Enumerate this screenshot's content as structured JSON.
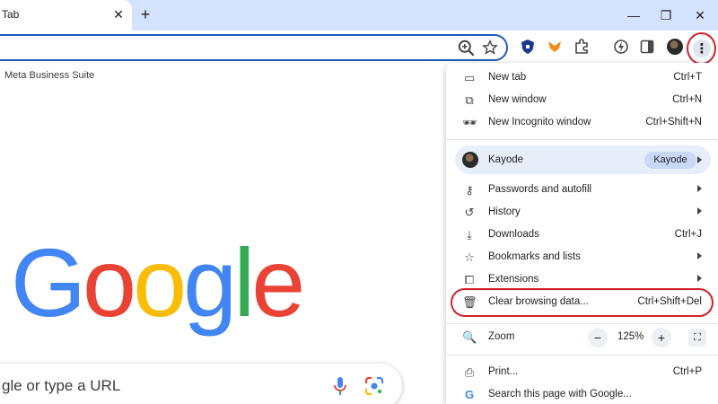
{
  "tab": {
    "title": "Tab",
    "close": "✕",
    "new_tab": "+"
  },
  "window_controls": {
    "minimize": "—",
    "maximize": "❐",
    "close": "✕"
  },
  "bookmarks_bar": {
    "item": "Meta Business Suite"
  },
  "google_logo": {
    "letters": [
      "G",
      "o",
      "o",
      "g",
      "l",
      "e"
    ],
    "colors": [
      "#4285F4",
      "#EA4335",
      "#FBBC05",
      "#4285F4",
      "#34A853",
      "#EA4335"
    ]
  },
  "search": {
    "placeholder": "gle or type a URL"
  },
  "menu": {
    "new_tab": {
      "label": "New tab",
      "shortcut": "Ctrl+T"
    },
    "new_window": {
      "label": "New window",
      "shortcut": "Ctrl+N"
    },
    "incognito": {
      "label": "New Incognito window",
      "shortcut": "Ctrl+Shift+N"
    },
    "profile": {
      "name": "Kayode",
      "chip": "Kayode"
    },
    "passwords": {
      "label": "Passwords and autofill"
    },
    "history": {
      "label": "History"
    },
    "downloads": {
      "label": "Downloads",
      "shortcut": "Ctrl+J"
    },
    "bookmarks": {
      "label": "Bookmarks and lists"
    },
    "extensions": {
      "label": "Extensions"
    },
    "clear_data": {
      "label": "Clear browsing data...",
      "shortcut": "Ctrl+Shift+Del"
    },
    "zoom": {
      "label": "Zoom",
      "minus": "−",
      "value": "125%",
      "plus": "+",
      "fullscreen": "⛶"
    },
    "print": {
      "label": "Print...",
      "shortcut": "Ctrl+P"
    },
    "search_page": {
      "label": "Search this page with Google..."
    }
  },
  "colors": {
    "highlight": "#d2202a",
    "tabstrip": "#d3e3fd",
    "accent": "#1f5bb8"
  }
}
